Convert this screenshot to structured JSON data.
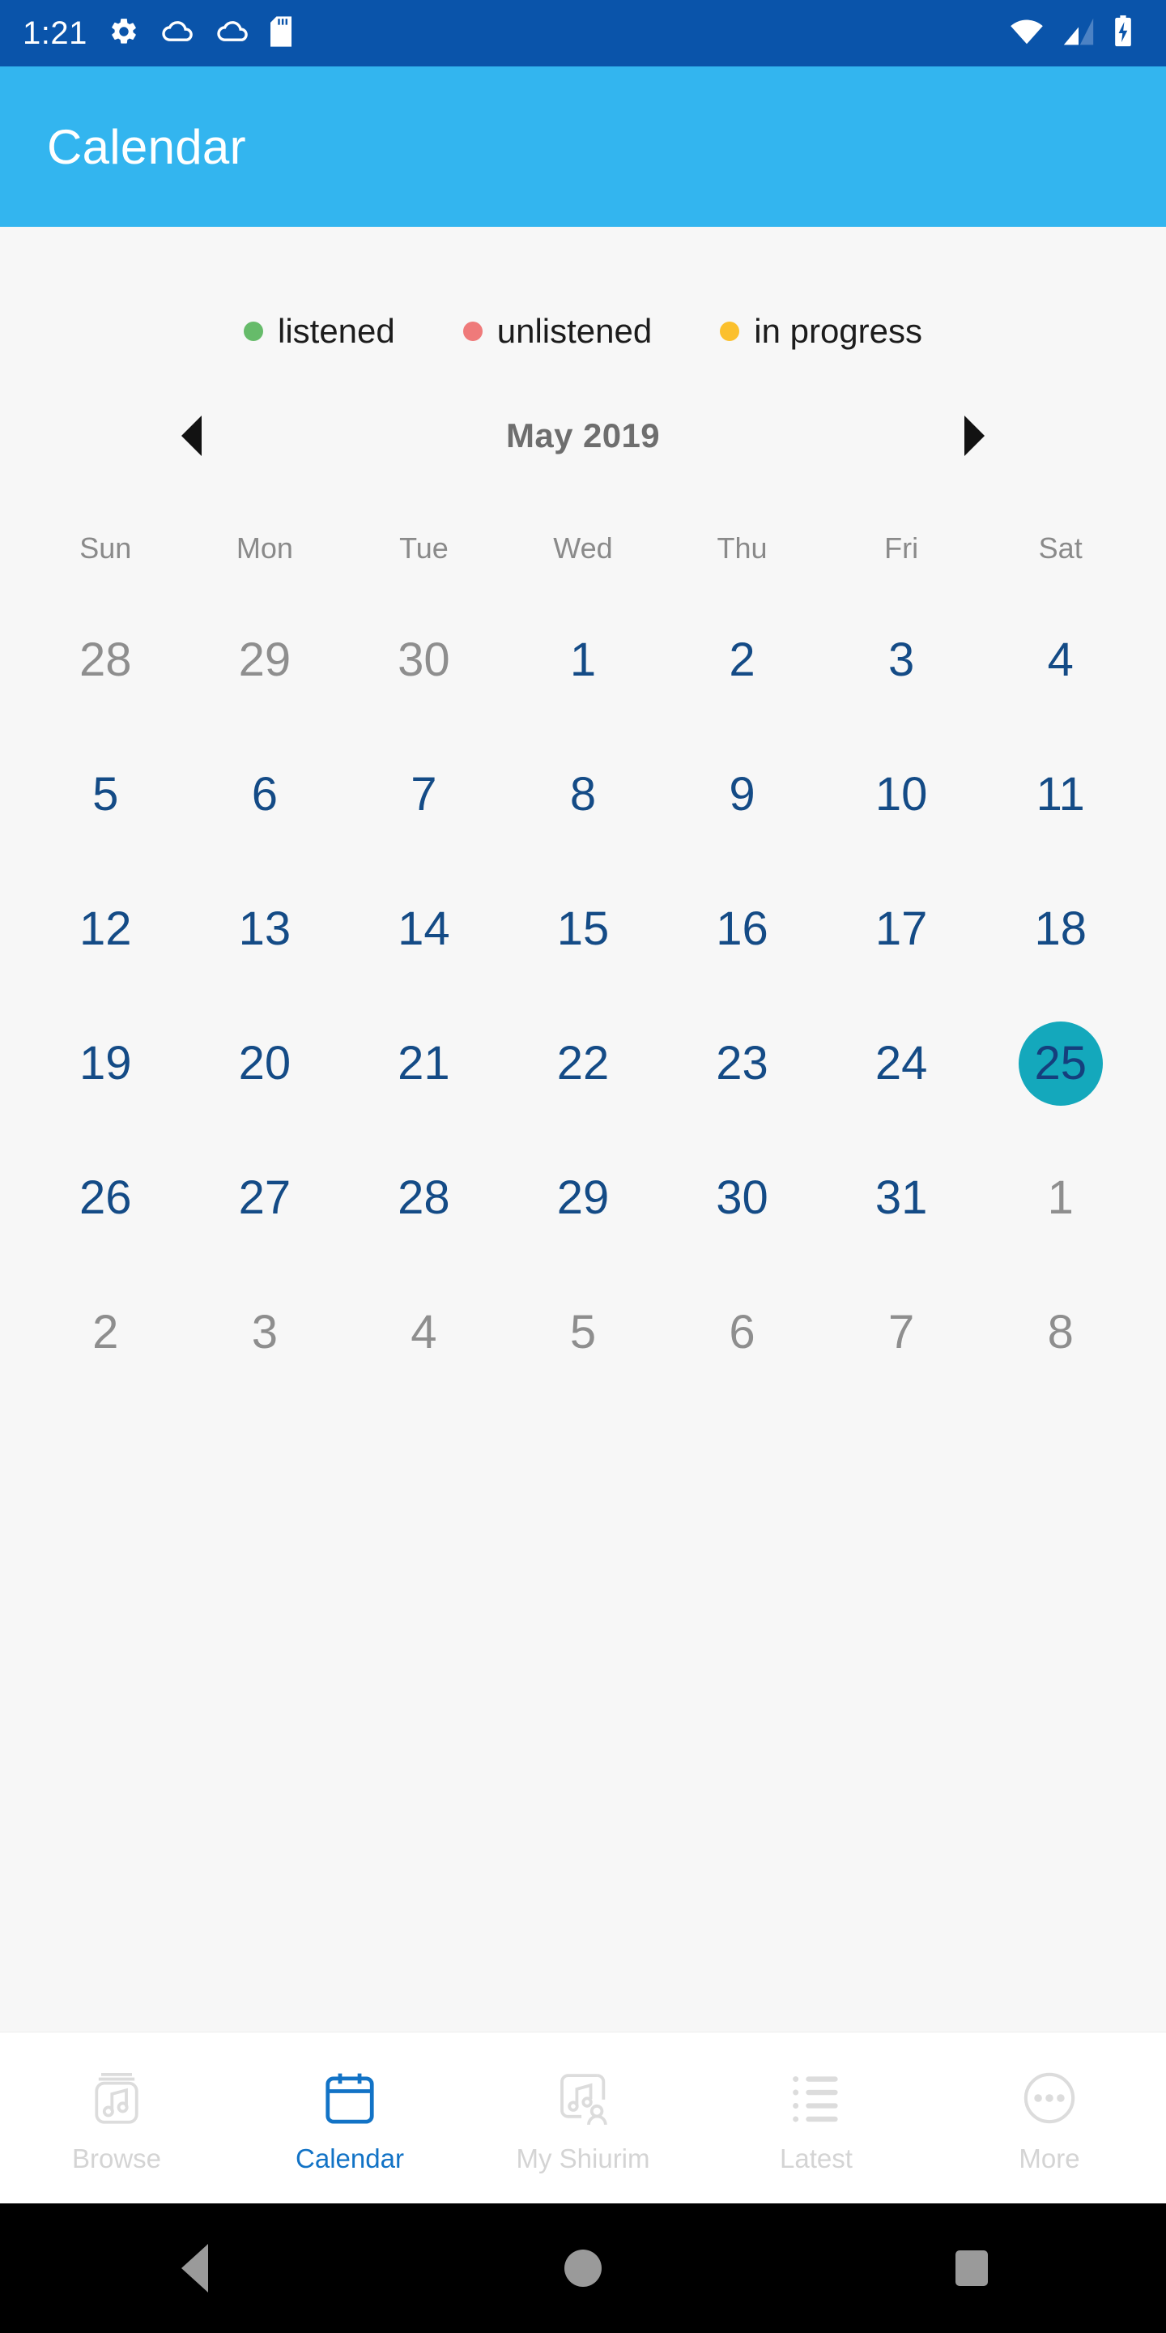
{
  "status_bar": {
    "time": "1:21",
    "left_icons": [
      "gear-icon",
      "cloud-icon",
      "cloud-icon",
      "sd-card-icon"
    ],
    "right_icons": [
      "wifi-icon",
      "cellular-signal-icon",
      "battery-charging-icon"
    ],
    "background_color": "#0A54AA"
  },
  "app_bar": {
    "title": "Calendar",
    "background_color": "#33B5EF",
    "title_color": "#FFFFFF"
  },
  "legend": {
    "items": [
      {
        "label": "listened",
        "color": "#66BB6A"
      },
      {
        "label": "unlistened",
        "color": "#EF7A7A"
      },
      {
        "label": "in progress",
        "color": "#FBC02D"
      }
    ]
  },
  "calendar": {
    "prev_label": "previous month",
    "next_label": "next month",
    "month_label": "May 2019",
    "weekdays": [
      "Sun",
      "Mon",
      "Tue",
      "Wed",
      "Thu",
      "Fri",
      "Sat"
    ],
    "selected_day": 25,
    "in_month_color": "#144B86",
    "out_month_color": "#8E8E8E",
    "selected_bg_color": "#14A8BC",
    "days": [
      {
        "n": "28",
        "in_month": false
      },
      {
        "n": "29",
        "in_month": false
      },
      {
        "n": "30",
        "in_month": false
      },
      {
        "n": "1",
        "in_month": true
      },
      {
        "n": "2",
        "in_month": true
      },
      {
        "n": "3",
        "in_month": true
      },
      {
        "n": "4",
        "in_month": true
      },
      {
        "n": "5",
        "in_month": true
      },
      {
        "n": "6",
        "in_month": true
      },
      {
        "n": "7",
        "in_month": true
      },
      {
        "n": "8",
        "in_month": true
      },
      {
        "n": "9",
        "in_month": true
      },
      {
        "n": "10",
        "in_month": true
      },
      {
        "n": "11",
        "in_month": true
      },
      {
        "n": "12",
        "in_month": true
      },
      {
        "n": "13",
        "in_month": true
      },
      {
        "n": "14",
        "in_month": true
      },
      {
        "n": "15",
        "in_month": true
      },
      {
        "n": "16",
        "in_month": true
      },
      {
        "n": "17",
        "in_month": true
      },
      {
        "n": "18",
        "in_month": true
      },
      {
        "n": "19",
        "in_month": true
      },
      {
        "n": "20",
        "in_month": true
      },
      {
        "n": "21",
        "in_month": true
      },
      {
        "n": "22",
        "in_month": true
      },
      {
        "n": "23",
        "in_month": true
      },
      {
        "n": "24",
        "in_month": true
      },
      {
        "n": "25",
        "in_month": true,
        "selected": true
      },
      {
        "n": "26",
        "in_month": true
      },
      {
        "n": "27",
        "in_month": true
      },
      {
        "n": "28",
        "in_month": true
      },
      {
        "n": "29",
        "in_month": true
      },
      {
        "n": "30",
        "in_month": true
      },
      {
        "n": "31",
        "in_month": true
      },
      {
        "n": "1",
        "in_month": false
      },
      {
        "n": "2",
        "in_month": false
      },
      {
        "n": "3",
        "in_month": false
      },
      {
        "n": "4",
        "in_month": false
      },
      {
        "n": "5",
        "in_month": false
      },
      {
        "n": "6",
        "in_month": false
      },
      {
        "n": "7",
        "in_month": false
      },
      {
        "n": "8",
        "in_month": false
      }
    ]
  },
  "bottom_nav": {
    "active_color": "#1273C6",
    "inactive_color": "#D4D4D4",
    "items": [
      {
        "label": "Browse",
        "icon": "music-library-icon",
        "active": false
      },
      {
        "label": "Calendar",
        "icon": "calendar-icon",
        "active": true
      },
      {
        "label": "My Shiurim",
        "icon": "my-music-person-icon",
        "active": false
      },
      {
        "label": "Latest",
        "icon": "list-icon",
        "active": false
      },
      {
        "label": "More",
        "icon": "more-ellipsis-icon",
        "active": false
      }
    ]
  },
  "android_nav": {
    "back_label": "Back",
    "home_label": "Home",
    "recents_label": "Recents"
  }
}
